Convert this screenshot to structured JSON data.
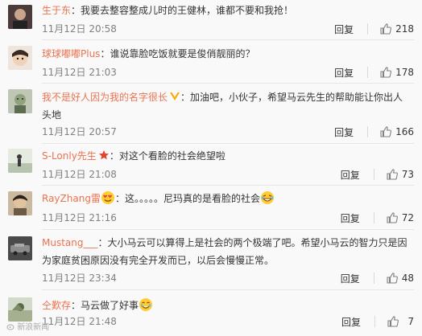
{
  "comments": [
    {
      "user": "生于东",
      "sep": "：",
      "text": "我要去整容整成儿时的王健林，谁都不要和我抢！",
      "time": "11月12日 20:58",
      "reply": "回复",
      "likes": "218"
    },
    {
      "user": "球球嘟嘟Plus",
      "sep": "：",
      "text": "谁说靠脸吃饭就要是俊俏靓丽的？",
      "time": "11月12日 21:03",
      "reply": "回复",
      "likes": "178"
    },
    {
      "user": "我不是好人因为我的名字很长",
      "sep": "：",
      "text_line1": "加油吧，小伙子，希望马云先生的帮助能让你出人",
      "text_line2": "头地",
      "time": "11月12日 20:57",
      "reply": "回复",
      "likes": "166"
    },
    {
      "user": "S-Lonly先生",
      "sep": "：",
      "text": "对这个看脸的社会绝望啦",
      "time": "11月12日 21:08",
      "reply": "回复",
      "likes": "73"
    },
    {
      "user": "RayZhang雷",
      "sep": "：",
      "text": "这。。。。。尼玛真的是看脸的社会",
      "time": "11月12日 21:16",
      "reply": "回复",
      "likes": "72"
    },
    {
      "user": "Mustang___",
      "sep": "：",
      "text_line1": "大小马云可以算得上是社会的两个极端了吧。希望小马云的智力只是因",
      "text_line2": "为家庭贫困原因没有完全开发而已，以后会慢慢正常。",
      "time": "11月12日 23:34",
      "reply": "回复",
      "likes": "48"
    },
    {
      "user": "仝歎存",
      "sep": "：",
      "text": "马云做了好事",
      "time": "11月12日 21:48",
      "reply": "回复",
      "likes": "7"
    }
  ],
  "watermark": "新浪新闻",
  "colors": {
    "username": "#eb7350",
    "meta": "#808080",
    "vip_badge": "#f6ab00",
    "star_badge": "#e8412c"
  }
}
